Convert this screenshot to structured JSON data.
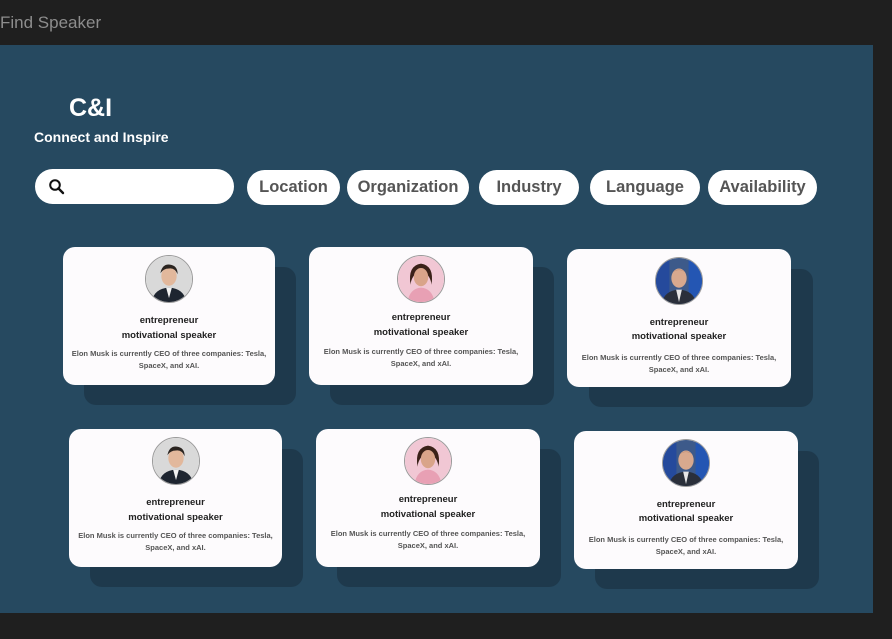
{
  "frame_title": "Find Speaker",
  "brand": {
    "title": "C&I",
    "tagline": "Connect and Inspire"
  },
  "search": {
    "placeholder": ""
  },
  "filters": [
    "Location",
    "Organization",
    "Industry",
    "Language",
    "Availability"
  ],
  "speakers": [
    {
      "avatar": "man-portrait-1",
      "role_line1": "entrepreneur",
      "role_line2": "motivational speaker",
      "bio": "Elon Musk is currently CEO of three companies: Tesla, SpaceX, and xAI."
    },
    {
      "avatar": "woman-portrait",
      "role_line1": "entrepreneur",
      "role_line2": "motivational speaker",
      "bio": "Elon Musk is currently CEO of three companies: Tesla, SpaceX, and xAI."
    },
    {
      "avatar": "man-portrait-2",
      "role_line1": "entrepreneur",
      "role_line2": "motivational speaker",
      "bio": "Elon Musk is currently CEO of three companies: Tesla, SpaceX, and xAI."
    },
    {
      "avatar": "man-portrait-1",
      "role_line1": "entrepreneur",
      "role_line2": "motivational speaker",
      "bio": "Elon Musk is currently CEO of three companies: Tesla, SpaceX, and xAI."
    },
    {
      "avatar": "woman-portrait",
      "role_line1": "entrepreneur",
      "role_line2": "motivational speaker",
      "bio": "Elon Musk is currently CEO of three companies: Tesla, SpaceX, and xAI."
    },
    {
      "avatar": "man-portrait-2",
      "role_line1": "entrepreneur",
      "role_line2": "motivational speaker",
      "bio": "Elon Musk is currently CEO of three companies: Tesla, SpaceX, and xAI."
    }
  ],
  "colors": {
    "canvas": "#1f1f1f",
    "frame": "#264960",
    "card": "#fdfbfd",
    "card_shadow": "#1e394c",
    "pill_text": "#555555"
  }
}
